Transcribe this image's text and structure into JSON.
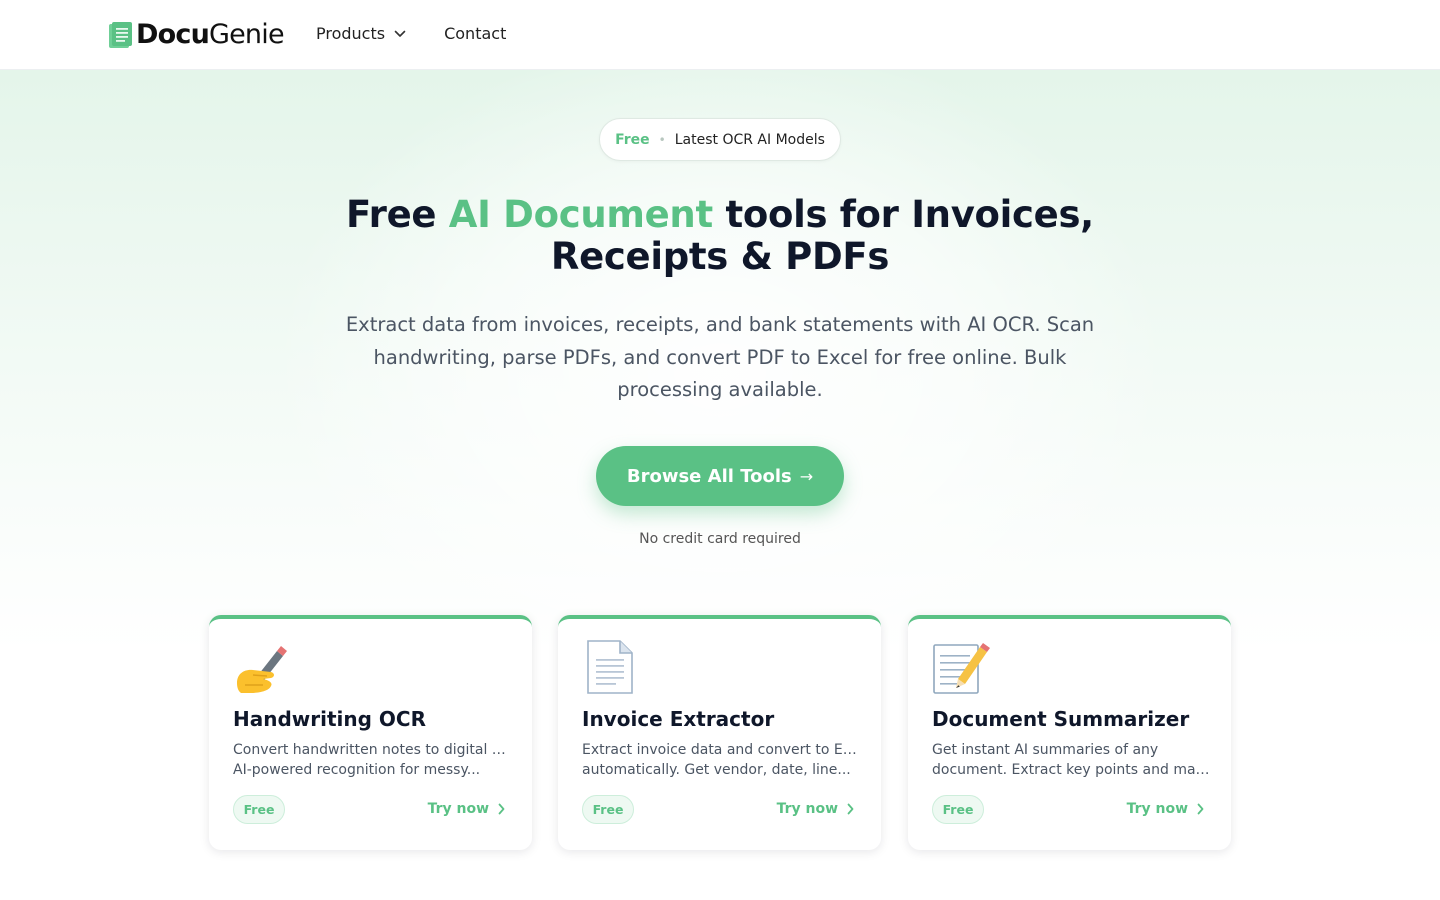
{
  "header": {
    "logo": {
      "part1": "Docu",
      "part2": "Genie"
    },
    "nav": [
      {
        "label": "Products",
        "has_dropdown": true
      },
      {
        "label": "Contact"
      }
    ]
  },
  "hero": {
    "badge": {
      "free": "Free",
      "text": "Latest OCR AI Models"
    },
    "title": {
      "pre": "Free ",
      "accent": "AI Document",
      "post": " tools for Invoices, Receipts & PDFs"
    },
    "subtitle": "Extract data from invoices, receipts, and bank statements with AI OCR. Scan handwriting, parse PDFs, and convert PDF to Excel for free online. Bulk processing available.",
    "cta": {
      "label": "Browse All Tools",
      "arrow": "→"
    },
    "note": "No credit card required"
  },
  "cards": [
    {
      "icon": "writing-hand-icon",
      "title": "Handwriting OCR",
      "desc_line1": "Convert handwritten notes to digital text.",
      "desc_line2": "AI-powered recognition for messy...",
      "badge": "Free",
      "action": "Try now"
    },
    {
      "icon": "document-icon",
      "title": "Invoice Extractor",
      "desc_line1": "Extract invoice data and convert to Excel",
      "desc_line2": "automatically. Get vendor, date, line...",
      "badge": "Free",
      "action": "Try now"
    },
    {
      "icon": "memo-pencil-icon",
      "title": "Document Summarizer",
      "desc_line1": "Get instant AI summaries of any",
      "desc_line2": "document. Extract key points and main...",
      "badge": "Free",
      "action": "Try now"
    }
  ],
  "colors": {
    "accent": "#5ac185",
    "heading": "#0f172a",
    "body": "#4b5563"
  }
}
